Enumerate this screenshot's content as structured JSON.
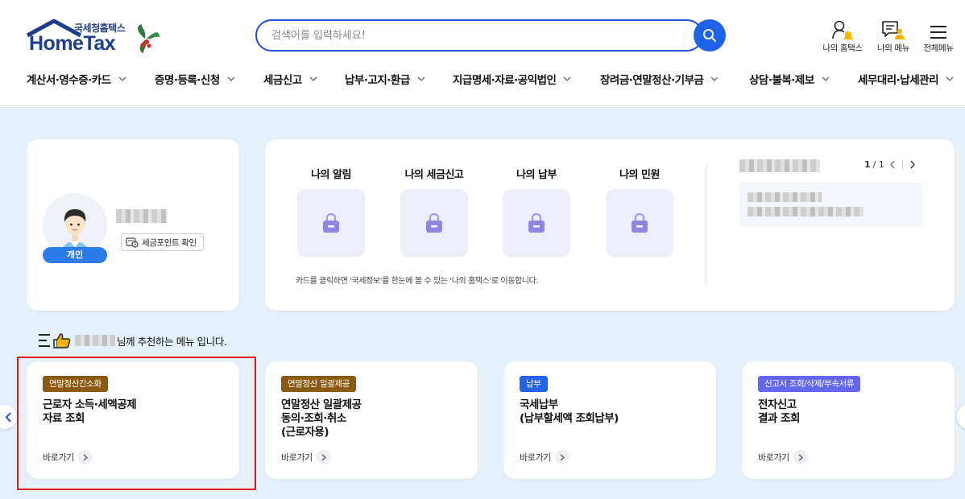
{
  "brand": {
    "sub": "국세청홈택스",
    "main": "HomeTax"
  },
  "search": {
    "placeholder": "검색어를 입력하세요!"
  },
  "util_menu": [
    {
      "label": "나의 홈택스",
      "icon": "person-bell-icon"
    },
    {
      "label": "나의 메뉴",
      "icon": "my-menu-icon"
    },
    {
      "label": "전체메뉴",
      "icon": "hamburger-menu-icon"
    }
  ],
  "gnb": [
    "계산서·영수증·카드",
    "증명·등록·신청",
    "세금신고",
    "납부·고지·환급",
    "지급명세·자료·공익법인",
    "장려금·연말정산·기부금",
    "상담·불복·제보",
    "세무대리·납세관리"
  ],
  "profile": {
    "badge": "개인",
    "point_button": "세금포인트 확인"
  },
  "my_hometax": {
    "tiles": [
      "나의 알림",
      "나의 세금신고",
      "나의 납부",
      "나의 민원"
    ],
    "note": "카드를 클릭하면 '국세정보'를 한눈에 볼 수 있는 '나의 홈택스'로 이동합니다.",
    "pager": {
      "current": "1",
      "total": "/ 1"
    }
  },
  "recommend": {
    "suffix": "님께 추천하는 메뉴 입니다."
  },
  "services": [
    {
      "tag": "연말정산간소화",
      "tag_color": "#8a5a10",
      "title": "근로자 소득·세액공제\n자료 조회",
      "go": "바로가기"
    },
    {
      "tag": "연말정산 일괄제공",
      "tag_color": "#8a5a10",
      "title": "연말정산 일괄제공\n동의·조회·취소\n(근로자용)",
      "go": "바로가기"
    },
    {
      "tag": "납부",
      "tag_color": "#2563eb",
      "title": "국세납부\n(납부할세액 조회납부)",
      "go": "바로가기"
    },
    {
      "tag": "신고서 조회/삭제/부속서류",
      "tag_color": "#6366f1",
      "title": "전자신고\n결과 조회",
      "go": "바로가기"
    }
  ],
  "colors": {
    "primary": "#1d63e8",
    "brand_navy": "#1d3f8a",
    "background": "#e6f0fa",
    "highlight": "#e11a1a"
  }
}
